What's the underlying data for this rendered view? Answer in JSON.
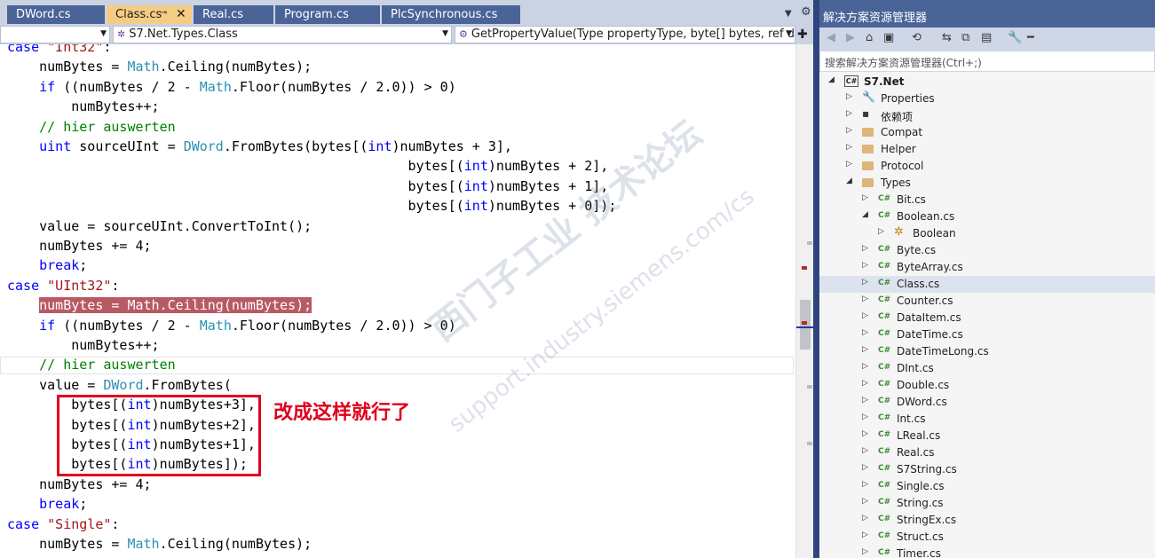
{
  "tabs": [
    {
      "label": "DWord.cs",
      "active": false
    },
    {
      "label": "Class.cs",
      "active": true,
      "pin": "⊸",
      "close": "✕"
    },
    {
      "label": "Real.cs",
      "active": false
    },
    {
      "label": "Program.cs",
      "active": false
    },
    {
      "label": "PlcSynchronous.cs",
      "active": false
    }
  ],
  "navbar": {
    "project": "",
    "type": "S7.Net.Types.Class",
    "member": "GetPropertyValue(Type propertyType, byte[] bytes, ref doub"
  },
  "code": {
    "lines": [
      [
        [
          "kw",
          "case "
        ],
        [
          "st",
          "\"Int32\""
        ],
        [
          "",
          ":"
        ]
      ],
      [
        [
          "",
          "    numBytes = "
        ],
        [
          "tp",
          "Math"
        ],
        [
          "",
          ".Ceiling(numBytes);"
        ]
      ],
      [
        [
          "kw",
          "    if"
        ],
        [
          "",
          " ((numBytes / 2 - "
        ],
        [
          "tp",
          "Math"
        ],
        [
          "",
          ".Floor(numBytes / 2.0)) > 0)"
        ]
      ],
      [
        [
          "",
          "        numBytes++;"
        ]
      ],
      [
        [
          "cm",
          "    // hier auswerten"
        ]
      ],
      [
        [
          "kw",
          "    uint"
        ],
        [
          "",
          " sourceUInt = "
        ],
        [
          "tp",
          "DWord"
        ],
        [
          "",
          ".FromBytes(bytes[("
        ],
        [
          "kw",
          "int"
        ],
        [
          "",
          ")numBytes + 3],"
        ]
      ],
      [
        [
          "",
          "                                                  bytes[("
        ],
        [
          "kw",
          "int"
        ],
        [
          "",
          ")numBytes + 2],"
        ]
      ],
      [
        [
          "",
          "                                                  bytes[("
        ],
        [
          "kw",
          "int"
        ],
        [
          "",
          ")numBytes + 1],"
        ]
      ],
      [
        [
          "",
          "                                                  bytes[("
        ],
        [
          "kw",
          "int"
        ],
        [
          "",
          ")numBytes + 0]);"
        ]
      ],
      [
        [
          "",
          "    value = sourceUInt.ConvertToInt();"
        ]
      ],
      [
        [
          "",
          "    numBytes += 4;"
        ]
      ],
      [
        [
          "kw",
          "    break"
        ],
        [
          "",
          ";"
        ]
      ],
      [
        [
          "kw",
          "case "
        ],
        [
          "st",
          "\"UInt32\""
        ],
        [
          "",
          ":"
        ]
      ],
      [
        [
          "",
          "    "
        ],
        [
          "hl",
          "numBytes = Math.Ceiling(numBytes);"
        ]
      ],
      [
        [
          "kw",
          "    if"
        ],
        [
          "",
          " ((numBytes / 2 - "
        ],
        [
          "tp",
          "Math"
        ],
        [
          "",
          ".Floor(numBytes / 2.0)) > 0)"
        ]
      ],
      [
        [
          "",
          "        numBytes++;"
        ]
      ],
      [
        [
          "cm",
          "    // hier auswerten"
        ]
      ],
      [
        [
          "",
          "    value = "
        ],
        [
          "tp",
          "DWord"
        ],
        [
          "",
          ".FromBytes("
        ]
      ],
      [
        [
          "",
          "        bytes[("
        ],
        [
          "kw",
          "int"
        ],
        [
          "",
          ")numBytes+3],"
        ]
      ],
      [
        [
          "",
          "        bytes[("
        ],
        [
          "kw",
          "int"
        ],
        [
          "",
          ")numBytes+2],"
        ]
      ],
      [
        [
          "",
          "        bytes[("
        ],
        [
          "kw",
          "int"
        ],
        [
          "",
          ")numBytes+1],"
        ]
      ],
      [
        [
          "",
          "        bytes[("
        ],
        [
          "kw",
          "int"
        ],
        [
          "",
          ")numBytes]);"
        ]
      ],
      [
        [
          "",
          "    numBytes += 4;"
        ]
      ],
      [
        [
          "kw",
          "    break"
        ],
        [
          "",
          ";"
        ]
      ],
      [
        [
          "kw",
          "case "
        ],
        [
          "st",
          "\"Single\""
        ],
        [
          "",
          ":"
        ]
      ],
      [
        [
          "",
          "    numBytes = "
        ],
        [
          "tp",
          "Math"
        ],
        [
          "",
          ".Ceiling(numBytes);"
        ]
      ]
    ]
  },
  "annotation": "改成这样就行了",
  "watermark": {
    "cn": "西门子工业 技术论坛",
    "en": "support.industry.siemens.com/cs"
  },
  "solution_explorer": {
    "title": "解决方案资源管理器",
    "search_placeholder": "搜索解决方案资源管理器(Ctrl+;)",
    "project": "S7.Net",
    "project_icon_text": "C#",
    "nodes": [
      {
        "label": "Properties",
        "icon": "properties-icon",
        "level": 1,
        "expander": "▷"
      },
      {
        "label": "依赖项",
        "icon": "dependencies-icon",
        "level": 1,
        "expander": "▷"
      },
      {
        "label": "Compat",
        "icon": "folder-icon",
        "level": 1,
        "expander": "▷"
      },
      {
        "label": "Helper",
        "icon": "folder-icon",
        "level": 1,
        "expander": "▷"
      },
      {
        "label": "Protocol",
        "icon": "folder-icon",
        "level": 1,
        "expander": "▷"
      },
      {
        "label": "Types",
        "icon": "folder-open-icon",
        "level": 1,
        "expander": "◢"
      },
      {
        "label": "Bit.cs",
        "icon": "csharp-file-icon",
        "level": 2,
        "expander": "▷"
      },
      {
        "label": "Boolean.cs",
        "icon": "csharp-file-icon",
        "level": 2,
        "expander": "◢"
      },
      {
        "label": "Boolean",
        "icon": "class-icon",
        "level": 3,
        "expander": "▷"
      },
      {
        "label": "Byte.cs",
        "icon": "csharp-file-icon",
        "level": 2,
        "expander": "▷"
      },
      {
        "label": "ByteArray.cs",
        "icon": "csharp-file-icon",
        "level": 2,
        "expander": "▷"
      },
      {
        "label": "Class.cs",
        "icon": "csharp-file-icon",
        "level": 2,
        "expander": "▷",
        "selected": true
      },
      {
        "label": "Counter.cs",
        "icon": "csharp-file-icon",
        "level": 2,
        "expander": "▷"
      },
      {
        "label": "DataItem.cs",
        "icon": "csharp-file-icon",
        "level": 2,
        "expander": "▷"
      },
      {
        "label": "DateTime.cs",
        "icon": "csharp-file-icon",
        "level": 2,
        "expander": "▷"
      },
      {
        "label": "DateTimeLong.cs",
        "icon": "csharp-file-icon",
        "level": 2,
        "expander": "▷"
      },
      {
        "label": "DInt.cs",
        "icon": "csharp-file-icon",
        "level": 2,
        "expander": "▷"
      },
      {
        "label": "Double.cs",
        "icon": "csharp-file-icon",
        "level": 2,
        "expander": "▷"
      },
      {
        "label": "DWord.cs",
        "icon": "csharp-file-icon",
        "level": 2,
        "expander": "▷"
      },
      {
        "label": "Int.cs",
        "icon": "csharp-file-icon",
        "level": 2,
        "expander": "▷"
      },
      {
        "label": "LReal.cs",
        "icon": "csharp-file-icon",
        "level": 2,
        "expander": "▷"
      },
      {
        "label": "Real.cs",
        "icon": "csharp-file-icon",
        "level": 2,
        "expander": "▷"
      },
      {
        "label": "S7String.cs",
        "icon": "csharp-file-icon",
        "level": 2,
        "expander": "▷"
      },
      {
        "label": "Single.cs",
        "icon": "csharp-file-icon",
        "level": 2,
        "expander": "▷"
      },
      {
        "label": "String.cs",
        "icon": "csharp-file-icon",
        "level": 2,
        "expander": "▷"
      },
      {
        "label": "StringEx.cs",
        "icon": "csharp-file-icon",
        "level": 2,
        "expander": "▷"
      },
      {
        "label": "Struct.cs",
        "icon": "csharp-file-icon",
        "level": 2,
        "expander": "▷"
      },
      {
        "label": "Timer.cs",
        "icon": "csharp-file-icon",
        "level": 2,
        "expander": "▷"
      }
    ]
  },
  "colors": {
    "accent": "#4a6498",
    "active_tab": "#f5cc84",
    "annotation": "#e0001b"
  }
}
